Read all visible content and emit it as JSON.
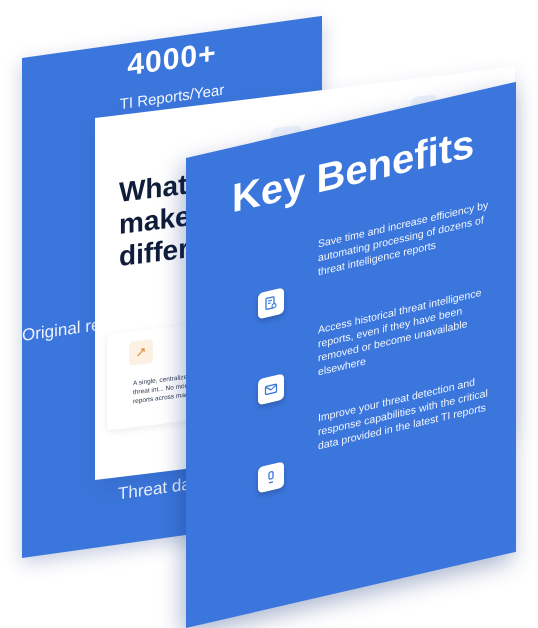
{
  "back_card": {
    "stat_value": "4000+",
    "stat_label": "TI Reports/Year",
    "side_text": "Original re",
    "bottom_text": "Threat data c"
  },
  "middle_card": {
    "heading_line1": "What",
    "heading_line2": "makes",
    "heading_line3": "differe",
    "top_icon": "cluster-icon",
    "corner_icon": "code-braces-icon",
    "feature": {
      "icon": "rocket-icon",
      "text": "A single, centralized... accessing threat int... No more time wasted... reports across many..."
    }
  },
  "front_card": {
    "title": "Key Benefits",
    "benefits": [
      {
        "icon": "document-search-icon",
        "text": "Save time and increase efficiency by automating processing of dozens of threat intelligence reports"
      },
      {
        "icon": "envelope-icon",
        "text": "Access historical threat intelligence reports, even if they have been removed or become unavailable elsewhere"
      },
      {
        "icon": "alert-icon",
        "text": "Improve your threat detection and response capabilities with the critical data provided in the latest TI reports"
      }
    ]
  },
  "colors": {
    "primary_blue": "#3b76dc",
    "dark_text": "#0f1d3a",
    "white": "#ffffff"
  }
}
